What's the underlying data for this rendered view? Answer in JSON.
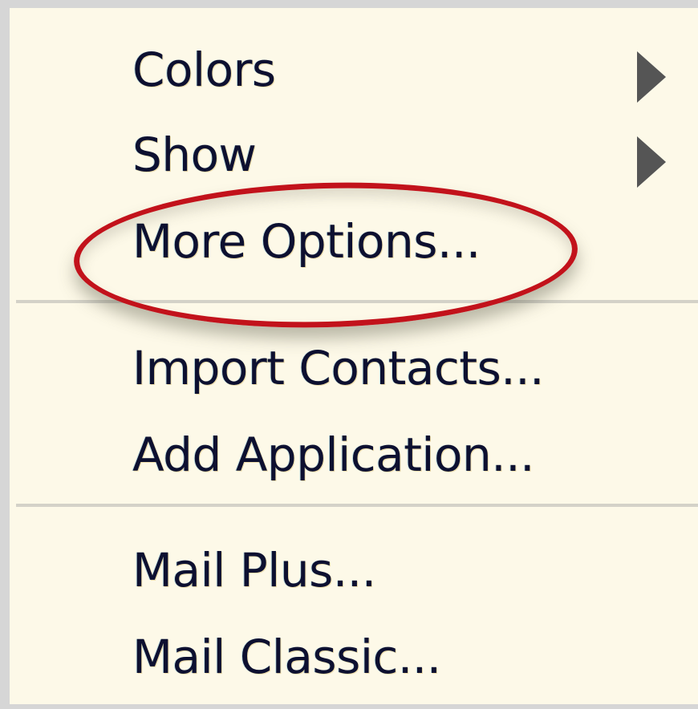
{
  "menu": {
    "items": [
      {
        "label": "Colors",
        "has_submenu": true
      },
      {
        "label": "Show",
        "has_submenu": true
      },
      {
        "label": "More Options...",
        "has_submenu": false
      },
      {
        "label": "Import Contacts...",
        "has_submenu": false
      },
      {
        "label": "Add Application...",
        "has_submenu": false
      },
      {
        "label": "Mail Plus...",
        "has_submenu": false
      },
      {
        "label": "Mail Classic...",
        "has_submenu": false
      }
    ]
  },
  "colors": {
    "menu_background": "#fdf9e8",
    "text": "#0d1030",
    "submenu_arrow": "#555555",
    "highlight_ring": "#c2121b"
  },
  "icons": {
    "submenu": "triangle-right-icon"
  }
}
